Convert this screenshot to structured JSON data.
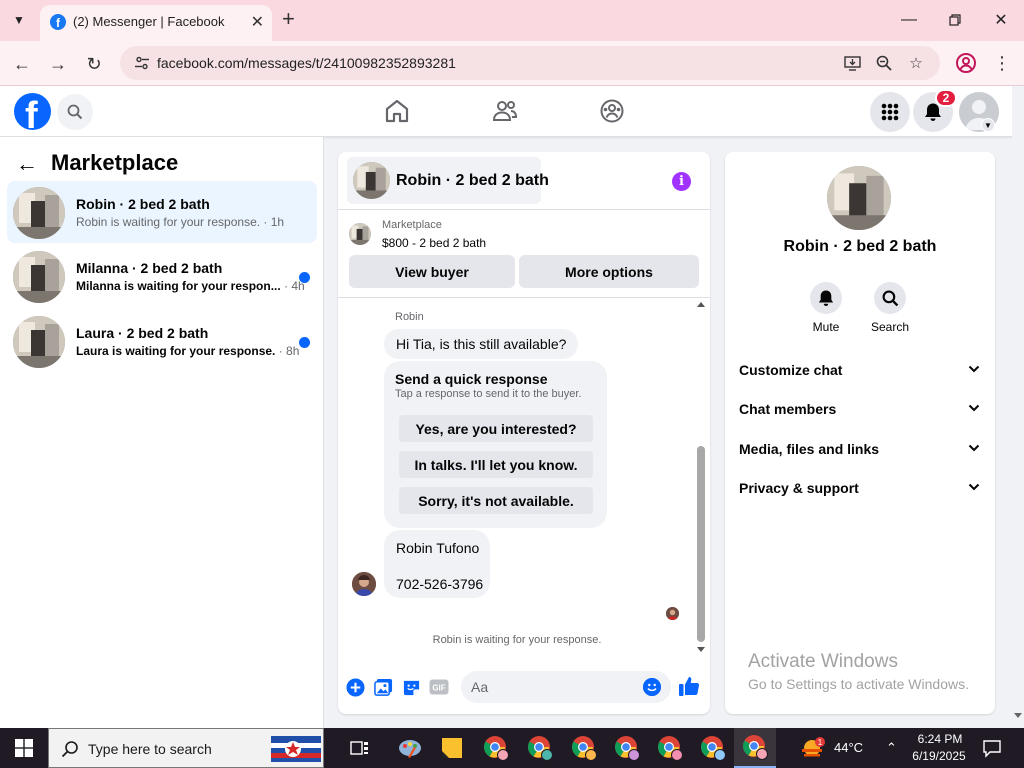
{
  "browser": {
    "tab_title": "(2) Messenger | Facebook",
    "url": "facebook.com/messages/t/24100982352893281"
  },
  "fb_header": {
    "notification_count": "2"
  },
  "marketplace": {
    "title": "Marketplace",
    "conversations": [
      {
        "name": "Robin · 2 bed 2 bath",
        "preview": "Robin is waiting for your response.",
        "time": " · 1h",
        "unread": false,
        "active": true
      },
      {
        "name": "Milanna · 2 bed 2 bath",
        "preview": "Milanna is waiting for your respon...",
        "time": " · 4h",
        "unread": true,
        "active": false
      },
      {
        "name": "Laura · 2 bed 2 bath",
        "preview": "Laura is waiting for your response.",
        "time": " · 8h",
        "unread": true,
        "active": false
      }
    ]
  },
  "chat": {
    "title": "Robin · 2 bed 2 bath",
    "listing_source": "Marketplace",
    "listing_price": "$800 - 2 bed 2 bath",
    "view_buyer_label": "View buyer",
    "more_options_label": "More options",
    "sender_label": "Robin",
    "message1": "Hi Tia, is this still available?",
    "quick_response": {
      "title": "Send a quick response",
      "subtitle": "Tap a response to send it to the buyer.",
      "options": [
        "Yes, are you interested?",
        "In talks. I'll let you know.",
        "Sorry, it's not available."
      ]
    },
    "message2_line1": "Robin Tufono",
    "message2_line2": "702-526-3796",
    "status": "Robin is waiting for your response.",
    "input_placeholder": "Aa"
  },
  "details": {
    "name": "Robin · 2 bed 2 bath",
    "mute_label": "Mute",
    "search_label": "Search",
    "sections": [
      "Customize chat",
      "Chat members",
      "Media, files and links",
      "Privacy & support"
    ]
  },
  "watermark": {
    "title": "Activate Windows",
    "subtitle": "Go to Settings to activate Windows."
  },
  "taskbar": {
    "search_placeholder": "Type here to search",
    "temperature": "44°C",
    "weather_badge": "1",
    "time": "6:24 PM",
    "date": "6/19/2025"
  },
  "colors": {
    "fb_blue": "#0866ff",
    "unread_dot": "#0866ff",
    "info_purple": "#a033ff",
    "badge_red": "#e41e3f",
    "tab_strip": "#fbd9e0"
  }
}
